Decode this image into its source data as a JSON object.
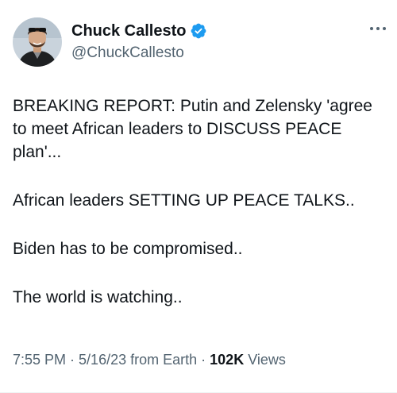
{
  "author": {
    "display_name": "Chuck Callesto",
    "handle": "@ChuckCallesto",
    "verified": true,
    "verified_icon": "verified-badge-icon",
    "accent_color": "#1d9bf0"
  },
  "tweet": {
    "paragraphs": [
      "BREAKING REPORT: Putin and Zelensky 'agree to meet African leaders to DISCUSS PEACE plan'...",
      "African leaders SETTING UP PEACE TALKS..",
      "Biden has to be compromised..",
      "The world is watching.."
    ]
  },
  "meta": {
    "time": "7:55 PM",
    "separator": " · ",
    "date": "5/16/23",
    "source": "from Earth",
    "views_count": "102K",
    "views_label": "Views"
  },
  "colors": {
    "text_primary": "#0f1419",
    "text_secondary": "#536471"
  }
}
